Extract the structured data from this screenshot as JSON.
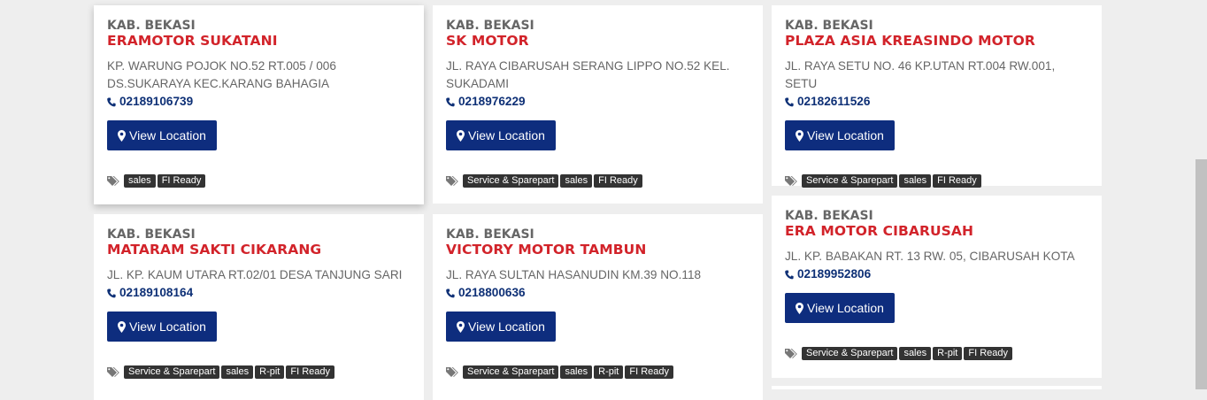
{
  "button_label": "View Location",
  "dealers": [
    {
      "region": "KAB. BEKASI",
      "name": "ERAMOTOR SUKATANI",
      "address": "KP. WARUNG POJOK NO.52 RT.005 / 006 DS.SUKARAYA KEC.KARANG BAHAGIA",
      "phone": "02189106739",
      "tags": [
        "sales",
        "FI Ready"
      ]
    },
    {
      "region": "KAB. BEKASI",
      "name": "SK MOTOR",
      "address": "JL. RAYA CIBARUSAH SERANG LIPPO NO.52 KEL. SUKADAMI",
      "phone": "0218976229",
      "tags": [
        "Service & Sparepart",
        "sales",
        "FI Ready"
      ]
    },
    {
      "region": "KAB. BEKASI",
      "name": "PLAZA ASIA KREASINDO MOTOR",
      "address": "JL. RAYA SETU NO. 46 KP.UTAN RT.004 RW.001, SETU",
      "phone": "02182611526",
      "tags": [
        "Service & Sparepart",
        "sales",
        "FI Ready"
      ]
    },
    {
      "region": "KAB. BEKASI",
      "name": "MATARAM SAKTI CIKARANG",
      "address": "JL. KP. KAUM UTARA RT.02/01 DESA TANJUNG SARI",
      "phone": "02189108164",
      "tags": [
        "Service & Sparepart",
        "sales",
        "R-pit",
        "FI Ready"
      ]
    },
    {
      "region": "KAB. BEKASI",
      "name": "VICTORY MOTOR TAMBUN",
      "address": "JL. RAYA SULTAN HASANUDIN KM.39 NO.118",
      "phone": "0218800636",
      "tags": [
        "Service & Sparepart",
        "sales",
        "R-pit",
        "FI Ready"
      ]
    },
    {
      "region": "KAB. BEKASI",
      "name": "ERA MOTOR CIBARUSAH",
      "address": "JL. KP. BABAKAN RT. 13 RW. 05, CIBARUSAH KOTA",
      "phone": "02189952806",
      "tags": [
        "Service & Sparepart",
        "sales",
        "R-pit",
        "FI Ready"
      ]
    }
  ],
  "colors": {
    "dealer_name": "#d2232a",
    "phone": "#0e3076",
    "button": "#0e2d7e",
    "tag": "#333333",
    "background": "#eeeeee"
  },
  "icons": {
    "phone": "phone-icon",
    "location": "map-marker-icon",
    "tags": "tags-icon"
  }
}
